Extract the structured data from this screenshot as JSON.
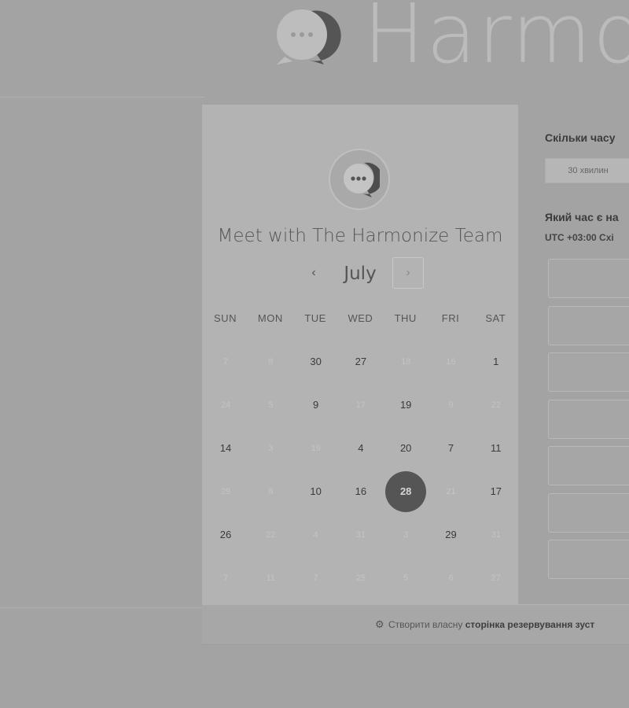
{
  "brand": {
    "name": "Harmonize"
  },
  "calendar": {
    "title": "Meet with The Harmonize Team",
    "month": "July",
    "prev_icon": "chevron-left-icon",
    "next_icon": "chevron-right-icon",
    "prev_glyph": "‹",
    "next_glyph": "›",
    "weekdays": [
      "SUN",
      "MON",
      "TUE",
      "WED",
      "THU",
      "FRI",
      "SAT"
    ],
    "weeks": [
      [
        {
          "d": "7",
          "available": false
        },
        {
          "d": "8",
          "available": false
        },
        {
          "d": "30",
          "available": true
        },
        {
          "d": "27",
          "available": true
        },
        {
          "d": "18",
          "available": false
        },
        {
          "d": "16",
          "available": false
        },
        {
          "d": "1",
          "available": true
        }
      ],
      [
        {
          "d": "24",
          "available": false
        },
        {
          "d": "5",
          "available": false
        },
        {
          "d": "9",
          "available": true
        },
        {
          "d": "17",
          "available": false
        },
        {
          "d": "19",
          "available": true
        },
        {
          "d": "9",
          "available": false
        },
        {
          "d": "22",
          "available": false
        }
      ],
      [
        {
          "d": "14",
          "available": true
        },
        {
          "d": "3",
          "available": false
        },
        {
          "d": "19",
          "available": false
        },
        {
          "d": "4",
          "available": true
        },
        {
          "d": "20",
          "available": true
        },
        {
          "d": "7",
          "available": true
        },
        {
          "d": "11",
          "available": true
        }
      ],
      [
        {
          "d": "29",
          "available": false
        },
        {
          "d": "8",
          "available": false
        },
        {
          "d": "10",
          "available": true
        },
        {
          "d": "16",
          "available": true
        },
        {
          "d": "28",
          "available": true,
          "selected": true
        },
        {
          "d": "21",
          "available": false
        },
        {
          "d": "17",
          "available": true
        }
      ],
      [
        {
          "d": "26",
          "available": true
        },
        {
          "d": "22",
          "available": false
        },
        {
          "d": "4",
          "available": false
        },
        {
          "d": "31",
          "available": false
        },
        {
          "d": "3",
          "available": false
        },
        {
          "d": "29",
          "available": true
        },
        {
          "d": "31",
          "available": false
        }
      ],
      [
        {
          "d": "7",
          "available": false
        },
        {
          "d": "11",
          "available": false
        },
        {
          "d": "7",
          "available": false
        },
        {
          "d": "25",
          "available": false
        },
        {
          "d": "5",
          "available": false
        },
        {
          "d": "6",
          "available": false
        },
        {
          "d": "27",
          "available": false
        }
      ]
    ]
  },
  "booking": {
    "duration_question": "Скільки часу",
    "duration_option": "30 хвилин",
    "time_question": "Який час є на",
    "timezone_offset": "UTC +03:00",
    "timezone_name": "Схі",
    "slot_count": 7
  },
  "footer": {
    "icon": "sprocket-icon",
    "prefix": "Створити власну",
    "bold": "сторінка резервування зуст"
  },
  "colors": {
    "selected_day": "#555555",
    "panel": "#b3b3b3",
    "background": "#a3a3a3"
  }
}
